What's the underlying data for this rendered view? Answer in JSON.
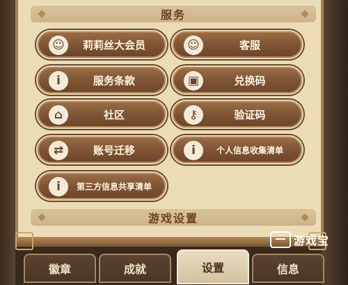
{
  "sections": {
    "service": "服务",
    "game_settings": "游戏设置"
  },
  "buttons": [
    {
      "label": "莉莉丝大会员",
      "icon": "headset-icon"
    },
    {
      "label": "客服",
      "icon": "headset-icon"
    },
    {
      "label": "服务条款",
      "icon": "info-icon"
    },
    {
      "label": "兑换码",
      "icon": "gift-icon"
    },
    {
      "label": "社区",
      "icon": "home-icon"
    },
    {
      "label": "验证码",
      "icon": "key-icon"
    },
    {
      "label": "账号迁移",
      "icon": "transfer-icon"
    },
    {
      "label": "个人信息收集清单",
      "icon": "info-icon"
    },
    {
      "label": "第三方信息共享清单",
      "icon": "info-icon"
    }
  ],
  "tabs": [
    {
      "label": "徽章"
    },
    {
      "label": "成就"
    },
    {
      "label": "设置",
      "active": true
    },
    {
      "label": "信息"
    }
  ],
  "watermark": {
    "text": "游戏宝"
  }
}
